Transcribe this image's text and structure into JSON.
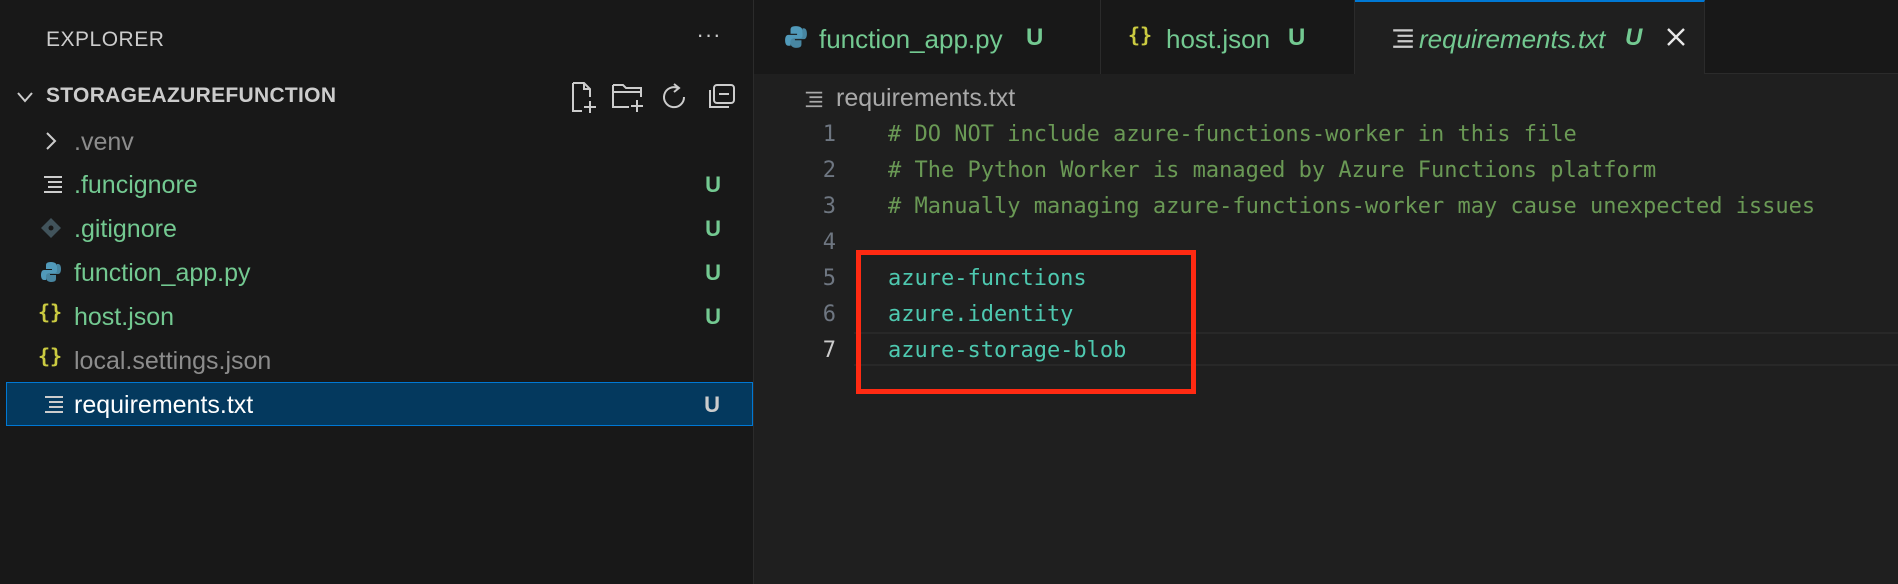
{
  "sidebar": {
    "title": "EXPLORER",
    "more_label": "···",
    "section_title": "STORAGEAZUREFUNCTION",
    "items": [
      {
        "label": ".venv",
        "badge": "",
        "icon": "chevron-right-icon"
      },
      {
        "label": ".funcignore",
        "badge": "U",
        "icon": "text-file-icon"
      },
      {
        "label": ".gitignore",
        "badge": "U",
        "icon": "git-file-icon"
      },
      {
        "label": "function_app.py",
        "badge": "U",
        "icon": "python-icon"
      },
      {
        "label": "host.json",
        "badge": "U",
        "icon": "json-icon"
      },
      {
        "label": "local.settings.json",
        "badge": "",
        "icon": "json-icon"
      },
      {
        "label": "requirements.txt",
        "badge": "U",
        "icon": "text-file-icon"
      }
    ]
  },
  "tabs": [
    {
      "label": "function_app.py",
      "badge": "U",
      "icon": "python-icon"
    },
    {
      "label": "host.json",
      "badge": "U",
      "icon": "json-icon"
    },
    {
      "label": "requirements.txt",
      "badge": "U",
      "icon": "text-file-icon"
    }
  ],
  "editor": {
    "breadcrumb": "requirements.txt",
    "lines": [
      {
        "num": "1",
        "text": "# DO NOT include azure-functions-worker in this file"
      },
      {
        "num": "2",
        "text": "# The Python Worker is managed by Azure Functions platform"
      },
      {
        "num": "3",
        "text": "# Manually managing azure-functions-worker may cause unexpected issues"
      },
      {
        "num": "4",
        "text": ""
      },
      {
        "num": "5",
        "text": "azure-functions"
      },
      {
        "num": "6",
        "text": "azure.identity"
      },
      {
        "num": "7",
        "text": "azure-storage-blob"
      }
    ]
  },
  "colors": {
    "accent": "#0078d4",
    "untracked": "#73c991",
    "highlight_box": "#ff2a12",
    "comment": "#6a9955",
    "json_icon": "#cbcb41",
    "python_icon": "#519aba"
  }
}
